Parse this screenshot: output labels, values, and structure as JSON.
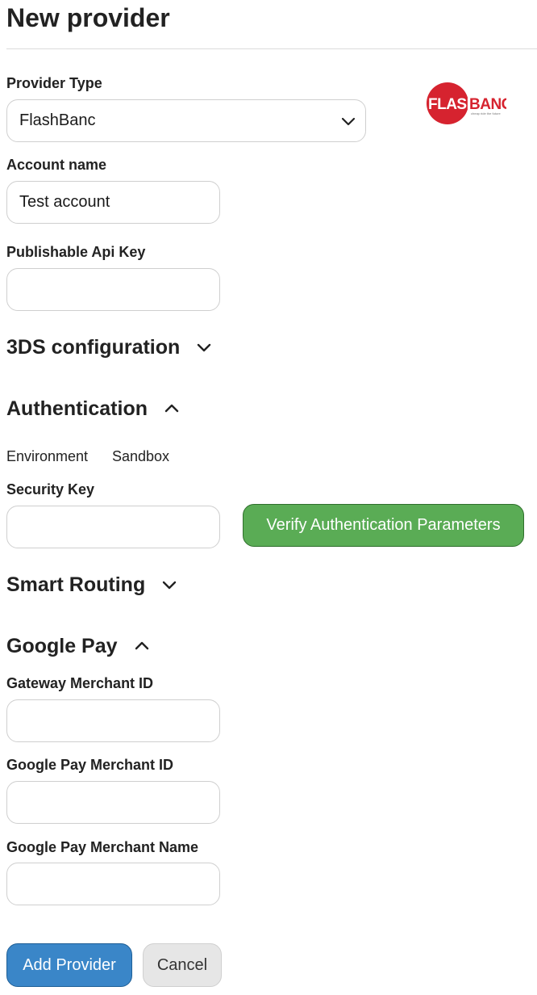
{
  "page": {
    "title": "New provider"
  },
  "provider_type": {
    "label": "Provider Type",
    "selected": "FlashBanc",
    "logo": {
      "brand_text_left": "FLASH",
      "brand_text_right": "BANC",
      "tagline": "cheap ride the future"
    }
  },
  "account_name": {
    "label": "Account name",
    "value": "Test account",
    "placeholder": ""
  },
  "publishable_api_key": {
    "label": "Publishable Api Key",
    "value": "",
    "placeholder": ""
  },
  "sections": {
    "three_ds": {
      "label": "3DS configuration",
      "icon": "chevron-down-icon"
    },
    "authentication": {
      "label": "Authentication",
      "icon": "chevron-up-icon"
    },
    "smart_routing": {
      "label": "Smart Routing",
      "icon": "chevron-down-icon"
    },
    "google_pay": {
      "label": "Google Pay",
      "icon": "chevron-up-icon"
    }
  },
  "authentication": {
    "environment_label": "Environment",
    "environment_value": "Sandbox",
    "security_key": {
      "label": "Security Key",
      "value": "",
      "placeholder": ""
    },
    "verify_button": "Verify Authentication Parameters"
  },
  "google_pay": {
    "gateway_merchant_id": {
      "label": "Gateway Merchant ID",
      "value": ""
    },
    "merchant_id": {
      "label": "Google Pay Merchant ID",
      "value": ""
    },
    "merchant_name": {
      "label": "Google Pay Merchant Name",
      "value": ""
    }
  },
  "actions": {
    "add_provider": "Add Provider",
    "cancel": "Cancel"
  },
  "colors": {
    "verify_green": "#5aac55",
    "primary_blue": "#3a86c8",
    "cancel_gray": "#e6e6e6",
    "logo_red": "#d6232f"
  }
}
